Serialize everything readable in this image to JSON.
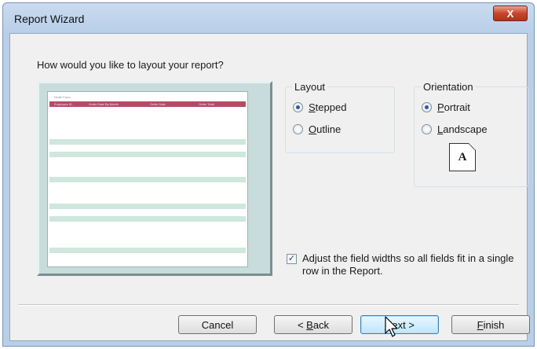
{
  "window": {
    "title": "Report Wizard",
    "close_label": "X"
  },
  "question": "How would you like to layout your report?",
  "preview": {
    "title": "Order Form",
    "columns": [
      "Employee ID",
      "Order Date By Month",
      "Order Date",
      "Order Total"
    ]
  },
  "layout": {
    "label": "Layout",
    "options": [
      {
        "mnemonic": "S",
        "rest": "tepped",
        "selected": true
      },
      {
        "mnemonic": "O",
        "rest": "utline",
        "selected": false
      }
    ]
  },
  "orientation": {
    "label": "Orientation",
    "options": [
      {
        "mnemonic": "P",
        "rest": "ortrait",
        "selected": true
      },
      {
        "mnemonic": "L",
        "rest": "andscape",
        "selected": false
      }
    ],
    "page_letter": "A"
  },
  "adjust_widths": {
    "checked": true,
    "check_glyph": "✓",
    "text": "Adjust the field widths so all fields fit in a single row in the Report."
  },
  "buttons": {
    "cancel": "Cancel",
    "back_prefix": "< ",
    "back_mnemonic": "B",
    "back_rest": "ack",
    "next_mnemonic": "N",
    "next_rest": "ext >",
    "finish_mnemonic": "F",
    "finish_rest": "inish"
  },
  "colors": {
    "title_bar": "#b9cfe8",
    "close_button": "#c8452c",
    "preview_header": "#b14c66",
    "preview_band": "#cfe7dd",
    "default_button": "#bee6fd"
  }
}
